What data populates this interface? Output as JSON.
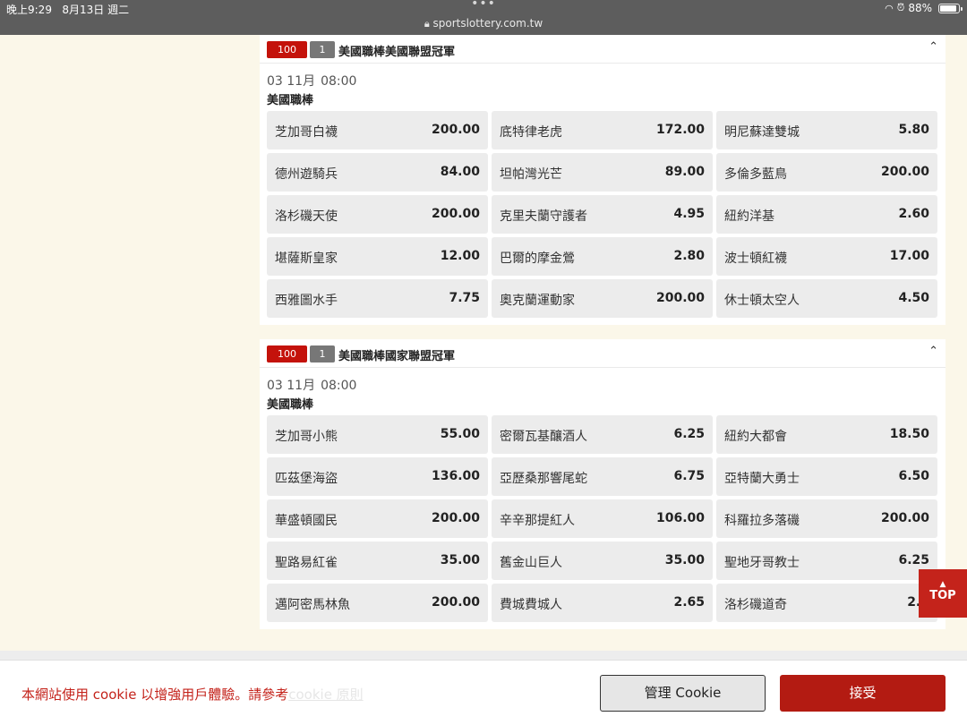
{
  "status_bar": {
    "time": "晚上9:29",
    "date": "8月13日 週二",
    "dots": "•••",
    "url": "sportslottery.com.tw",
    "battery": "88%",
    "battery_level": 0.88
  },
  "sections": [
    {
      "code": "100",
      "num": "1",
      "title": "美國職棒美國聯盟冠軍",
      "collapse_icon": "chevron-up-icon",
      "date": "03 11月",
      "time": "08:00",
      "sport": "美國職棒",
      "odds": [
        {
          "team": "芝加哥白襪",
          "odds": "200.00"
        },
        {
          "team": "底特律老虎",
          "odds": "172.00"
        },
        {
          "team": "明尼蘇達雙城",
          "odds": "5.80"
        },
        {
          "team": "德州遊騎兵",
          "odds": "84.00"
        },
        {
          "team": "坦帕灣光芒",
          "odds": "89.00"
        },
        {
          "team": "多倫多藍鳥",
          "odds": "200.00"
        },
        {
          "team": "洛杉磯天使",
          "odds": "200.00"
        },
        {
          "team": "克里夫蘭守護者",
          "odds": "4.95"
        },
        {
          "team": "紐約洋基",
          "odds": "2.60"
        },
        {
          "team": "堪薩斯皇家",
          "odds": "12.00"
        },
        {
          "team": "巴爾的摩金鶯",
          "odds": "2.80"
        },
        {
          "team": "波士頓紅襪",
          "odds": "17.00"
        },
        {
          "team": "西雅圖水手",
          "odds": "7.75"
        },
        {
          "team": "奧克蘭運動家",
          "odds": "200.00"
        },
        {
          "team": "休士頓太空人",
          "odds": "4.50"
        }
      ]
    },
    {
      "code": "100",
      "num": "1",
      "title": "美國職棒國家聯盟冠軍",
      "collapse_icon": "chevron-up-icon",
      "date": "03 11月",
      "time": "08:00",
      "sport": "美國職棒",
      "odds": [
        {
          "team": "芝加哥小熊",
          "odds": "55.00"
        },
        {
          "team": "密爾瓦基釀酒人",
          "odds": "6.25"
        },
        {
          "team": "紐約大都會",
          "odds": "18.50"
        },
        {
          "team": "匹茲堡海盜",
          "odds": "136.00"
        },
        {
          "team": "亞歷桑那響尾蛇",
          "odds": "6.75"
        },
        {
          "team": "亞特蘭大勇士",
          "odds": "6.50"
        },
        {
          "team": "華盛頓國民",
          "odds": "200.00"
        },
        {
          "team": "辛辛那提紅人",
          "odds": "106.00"
        },
        {
          "team": "科羅拉多落磯",
          "odds": "200.00"
        },
        {
          "team": "聖路易紅雀",
          "odds": "35.00"
        },
        {
          "team": "舊金山巨人",
          "odds": "35.00"
        },
        {
          "team": "聖地牙哥教士",
          "odds": "6.25"
        },
        {
          "team": "邁阿密馬林魚",
          "odds": "200.00"
        },
        {
          "team": "費城費城人",
          "odds": "2.65"
        },
        {
          "team": "洛杉磯道奇",
          "odds": "2.0"
        }
      ]
    }
  ],
  "top_button": {
    "arrow": "▲",
    "label": "TOP"
  },
  "cookie": {
    "text": "本網站使用 cookie 以增強用戶體驗。請參考",
    "link": "cookie 原則",
    "manage_label": "管理 Cookie",
    "accept_label": "接受"
  },
  "colors": {
    "accent": "#c4231b",
    "background": "#fbf7e9",
    "cell": "#ececec"
  }
}
